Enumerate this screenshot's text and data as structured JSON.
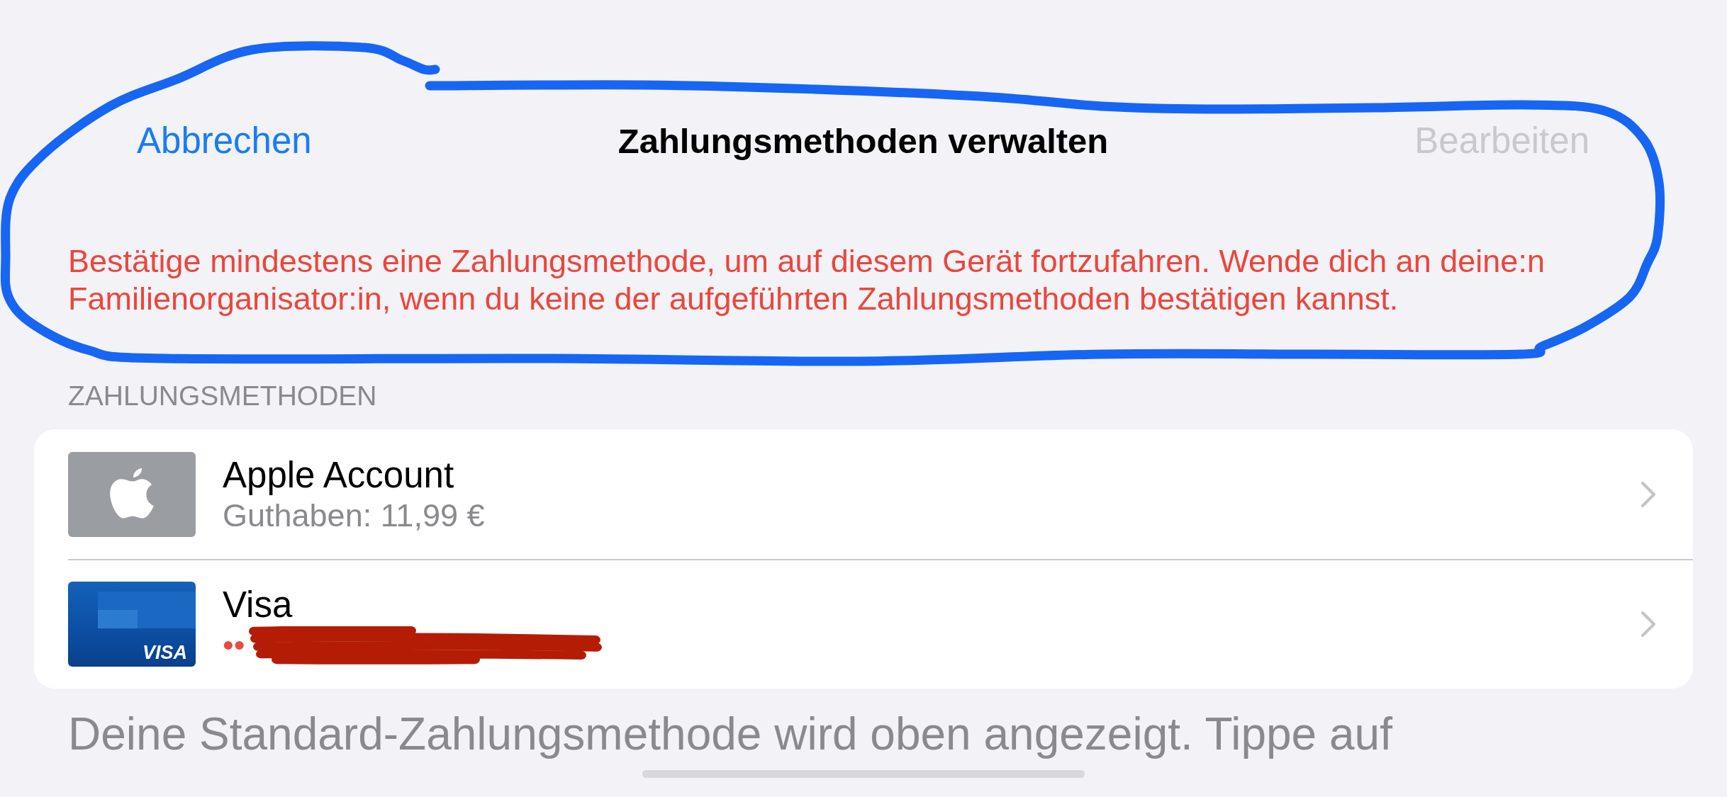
{
  "nav": {
    "cancel": {
      "label": "Abbrechen"
    },
    "title": "Zahlungsmethoden verwalten",
    "edit": {
      "label": "Bearbeiten",
      "disabled": true
    }
  },
  "hand_drawn_outline": true,
  "alert": "Bestätige mindestens eine Zahlungsmethode, um auf diesem Gerät fortzufahren. Wende dich an deine:n Familienorganisator:in, wenn du keine der aufgeführten Zahlungsmethoden bestätigen kannst.",
  "section": {
    "header": "ZAHLUNGSMETHODEN",
    "methods": [
      {
        "kind": "apple",
        "title": "Apple Account",
        "subtitle": "Guthaben: 11,99 €",
        "subtitle_alert": false,
        "redacted": false
      },
      {
        "kind": "visa",
        "title": "Visa",
        "card_label": "VISA",
        "subtitle": "••",
        "subtitle_alert": true,
        "redacted": true
      }
    ]
  },
  "footer": "Deine Standard-Zahlungsmethode wird oben angezeigt. Tippe auf"
}
